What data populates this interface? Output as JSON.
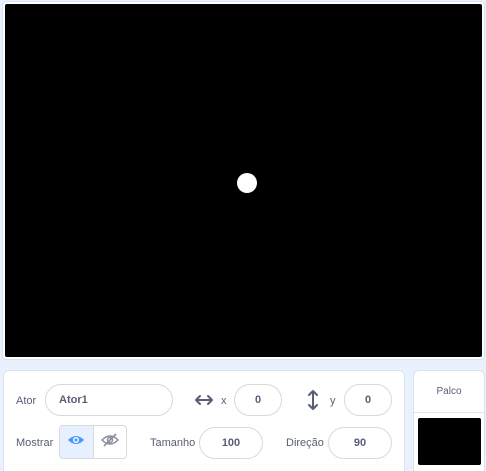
{
  "stage": {
    "background": "#000000",
    "sprite_color": "#ffffff"
  },
  "sprite_info": {
    "sprite_label": "Ator",
    "sprite_name": "Ator1",
    "x_label": "x",
    "x_value": "0",
    "y_label": "y",
    "y_value": "0",
    "show_label": "Mostrar",
    "show_icon": "eye-icon",
    "hide_icon": "eye-slash-icon",
    "size_label": "Tamanho",
    "size_value": "100",
    "direction_label": "Direção",
    "direction_value": "90"
  },
  "stage_selector": {
    "title": "Palco"
  },
  "colors": {
    "accent": "#4c97ff",
    "text": "#575e75",
    "panel_bg": "#e9f1fc"
  }
}
